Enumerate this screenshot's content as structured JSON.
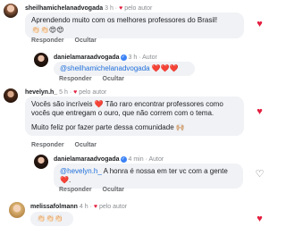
{
  "comments": [
    {
      "username": "sheilhamichelanadvogada",
      "time": "3 h",
      "author_tag": "pelo autor",
      "text": "Aprendendo muito com os melhores professores do Brasil!",
      "emojis": "👏🏻👏🏻😍😍",
      "reply_label": "Responder",
      "hide_label": "Ocultar"
    },
    {
      "username": "danielamaraadvogada",
      "time": "3 h",
      "author_label": "Autor",
      "mention": "@sheilhamichelanadvogada",
      "emojis": "❤️❤️❤️",
      "reply_label": "Responder",
      "hide_label": "Ocultar"
    },
    {
      "username": "hevelyn.h_",
      "time": "5 h",
      "author_tag": "pelo autor",
      "paragraph1": "Vocês são incríveis ❤️ Tão raro encontrar professores como vocês que entregam o ouro, que não correm com o tema.",
      "paragraph2": "Muito feliz por fazer parte dessa comunidade 🙌🏼",
      "reply_label": "Responder",
      "hide_label": "Ocultar"
    },
    {
      "username": "danielamaraadvogada",
      "time": "4 min",
      "author_label": "Autor",
      "mention": "@hevelyn.h_",
      "text": " A honra é nossa em ter vc com a gente ❤️.",
      "reply_label": "Responder",
      "hide_label": "Ocultar"
    },
    {
      "username": "melissafolmann",
      "time": "4 h",
      "author_tag": "pelo autor",
      "emojis": "👏🏻👏🏻👏🏻"
    }
  ],
  "colors": {
    "heart": "#e41e3f",
    "mention": "#216fdb",
    "bubble": "#f0f2f5",
    "verified": "#3b82f6"
  },
  "icons": [
    "heart-icon",
    "verified-badge-icon"
  ]
}
